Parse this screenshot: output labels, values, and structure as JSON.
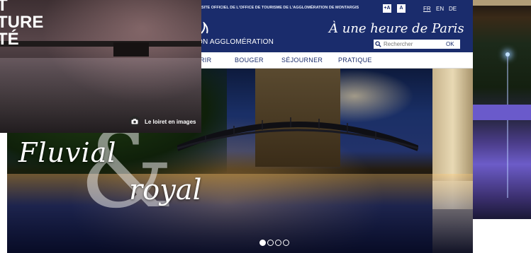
{
  "overlay": {
    "title_line1": "T",
    "title_line2": "TURE",
    "title_line3": "TÉ",
    "caption": "Le loiret en images",
    "icon": "camera-icon"
  },
  "header": {
    "official_text": "SITE OFFICIEL DE L'OFFICE DE TOURISME DE L'AGGLOMÉRATION DE MONTARGIS",
    "text_size_buttons": [
      "+A",
      "A"
    ],
    "languages": [
      {
        "code": "FR",
        "active": true
      },
      {
        "code": "EN",
        "active": false
      },
      {
        "code": "DE",
        "active": false
      }
    ],
    "brand_name": "ON AGGLOMÉRATION",
    "slogan": "À une heure de Paris",
    "search": {
      "placeholder": "Rechercher",
      "button": "OK",
      "icon": "search-icon"
    },
    "nav": [
      "RIR",
      "BOUGER",
      "SÉJOURNER",
      "PRATIQUE"
    ]
  },
  "hero": {
    "tagline_word1": "Fluvial",
    "tagline_amp": "&",
    "tagline_word2": "royal",
    "carousel": {
      "count": 4,
      "active_index": 0
    }
  },
  "colors": {
    "brand_blue": "#1a2c6c",
    "white": "#ffffff"
  }
}
